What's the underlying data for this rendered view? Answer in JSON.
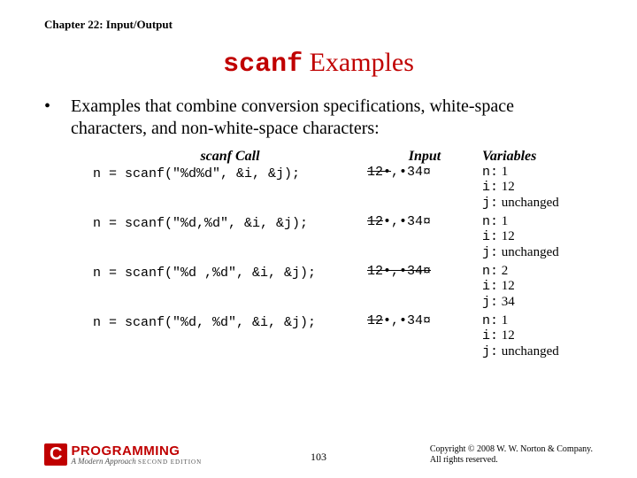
{
  "chapter": "Chapter 22: Input/Output",
  "title_code": "scanf",
  "title_rest": " Examples",
  "bullet": "Examples that combine conversion specifications, white-space characters, and non-white-space characters:",
  "headers": {
    "call": "scanf Call",
    "input": "Input",
    "vars": "Variables"
  },
  "rows": [
    {
      "call": "n = scanf(\"%d%d\", &i, &j);",
      "input_pre": "12•",
      "input_post": ",•34¤",
      "consumed_all": false,
      "n": "1",
      "i": "12",
      "j": "unchanged"
    },
    {
      "call": "n = scanf(\"%d,%d\", &i, &j);",
      "input_pre": "12",
      "input_post": "•,•34¤",
      "consumed_all": false,
      "n": "1",
      "i": "12",
      "j": "unchanged"
    },
    {
      "call": "n = scanf(\"%d ,%d\", &i, &j);",
      "input_pre": "12•,•34",
      "input_post": "¤",
      "consumed_all": true,
      "n": "2",
      "i": "12",
      "j": "34"
    },
    {
      "call": "n = scanf(\"%d, %d\", &i, &j);",
      "input_pre": "12",
      "input_post": "•,•34¤",
      "consumed_all": false,
      "n": "1",
      "i": "12",
      "j": "unchanged"
    }
  ],
  "var_labels": {
    "n": "n:",
    "i": "i:",
    "j": "j:"
  },
  "page_number": "103",
  "copyright_l1": "Copyright © 2008 W. W. Norton & Company.",
  "copyright_l2": "All rights reserved.",
  "logo": {
    "c": "C",
    "prog": "PROGRAMMING",
    "sub": "A Modern Approach",
    "ed": "SECOND EDITION"
  }
}
